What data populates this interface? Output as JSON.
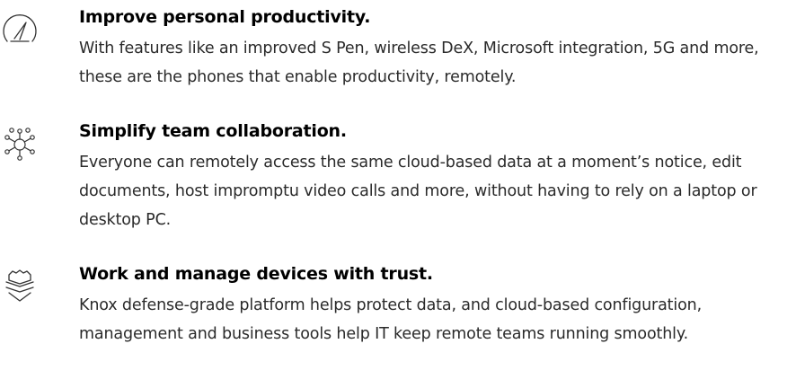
{
  "features": [
    {
      "icon": "speedometer-icon",
      "title": "Improve personal productivity.",
      "description": "With features like an improved S Pen, wireless DeX, Microsoft integration, 5G and more, these are the phones that enable productivity, remotely."
    },
    {
      "icon": "network-hub-icon",
      "title": "Simplify team collaboration.",
      "description": "Everyone can remotely access the same cloud-based data at a moment’s notice, edit documents, host impromptu video calls and more, without having to rely on a laptop or desktop PC."
    },
    {
      "icon": "shield-icon",
      "title": "Work and manage devices with trust.",
      "description": "Knox defense-grade platform helps protect data, and cloud-based configuration, management and business tools help IT keep remote teams running smoothly."
    }
  ],
  "colors": {
    "title": "#000000",
    "text": "#2a2a2a",
    "icon_stroke": "#333333"
  }
}
